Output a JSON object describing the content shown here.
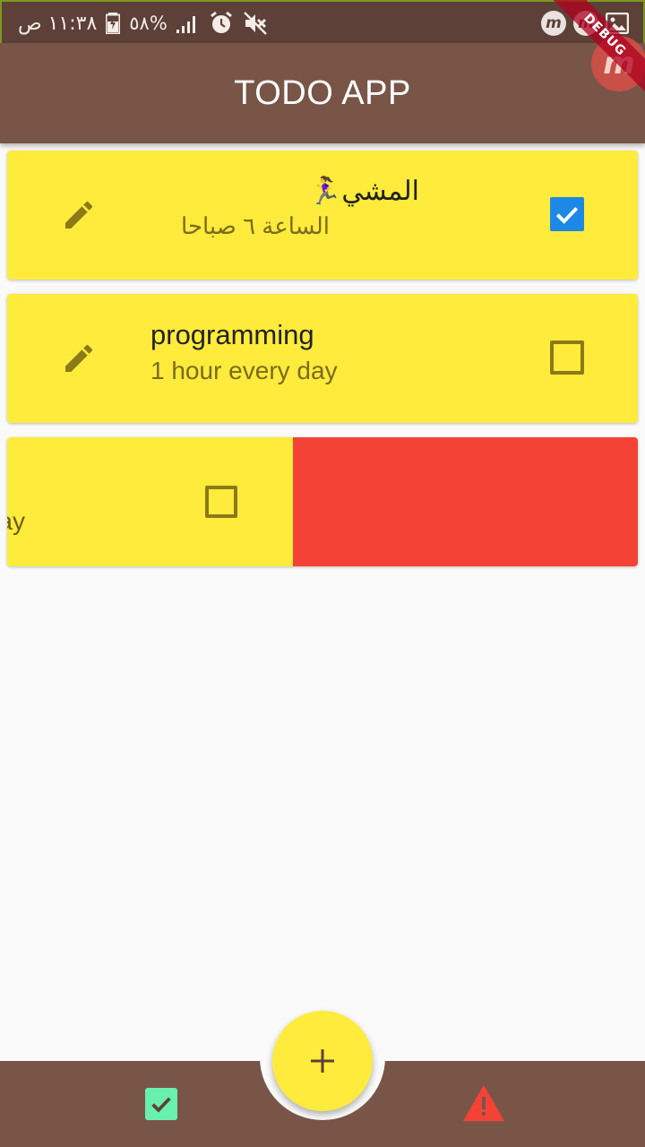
{
  "status_bar": {
    "time": "١١:٣٨ ص",
    "battery_percent": "%٥٨",
    "icons": [
      "battery-icon",
      "signal-icon",
      "alarm-icon",
      "mute-icon",
      "notification-m-icon",
      "notification-m-icon",
      "image-icon"
    ]
  },
  "debug_banner": "DEBUG",
  "app_bar": {
    "title": "TODO APP"
  },
  "tasks": [
    {
      "title": "المشي🏃‍♀️",
      "subtitle": "الساعة ٦ صباحا",
      "done": true
    },
    {
      "title": "programming",
      "subtitle": "1 hour every day",
      "done": false
    },
    {
      "subtitle_visible_fragment": "ay",
      "done": false
    }
  ],
  "bottom_nav": {
    "items": [
      {
        "icon": "check-box-icon",
        "color": "#69f0ae"
      },
      {
        "icon": "warning-icon",
        "color": "#f44336"
      }
    ],
    "fab_icon": "add-icon"
  },
  "colors": {
    "app_bar": "#795548",
    "status_bar": "#5d4037",
    "card": "#ffeb3b",
    "swipe_delete": "#f44336",
    "checkbox_checked": "#1e88e5"
  }
}
